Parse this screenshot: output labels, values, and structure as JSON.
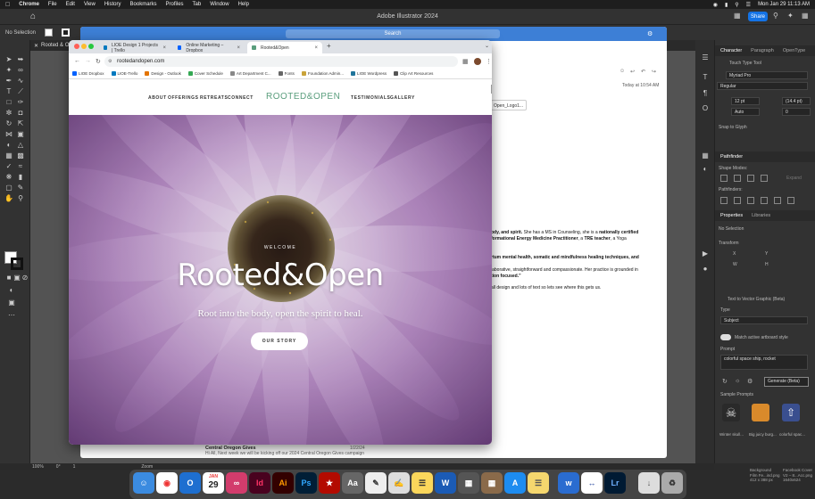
{
  "menubar": {
    "app": "Chrome",
    "items": [
      "File",
      "Edit",
      "View",
      "History",
      "Bookmarks",
      "Profiles",
      "Tab",
      "Window",
      "Help"
    ],
    "datetime": "Mon Jan 29 11:13 AM"
  },
  "illustrator": {
    "title": "Adobe Illustrator 2024",
    "share": "Share",
    "control_selection": "No Selection",
    "doc_tab": "Rooted & Ope",
    "zoom": "100%",
    "angle": "0°",
    "artboard": "1",
    "status": "Zoom"
  },
  "gmail": {
    "search": "Search",
    "time": "Today at 10:54 AM",
    "attachment": "Open_Logo1...",
    "body": [
      {
        "prefix": "",
        "bold": "ody, and spirit.",
        "rest": " She has a MS in Counseling, she is a "
      },
      {
        "prefix": "",
        "bold": "nationally certified",
        "rest": ""
      },
      {
        "prefix": "",
        "bold": "formational Energy Medicine Practitioner",
        "rest": ", a "
      },
      {
        "prefix": "",
        "bold": "TRE teacher",
        "rest": ", a Yoga"
      }
    ],
    "body_line5": "rtum mental health, somatic and mindfulness healing techniques, and",
    "body_line6": "laborative, straightforward and compassionate. Her practice is grounded in",
    "body_line7": "tion focused.”",
    "body_line8": "all design and lots of text so lets see where this gets us.",
    "footer_name": "Central Oregon Gives",
    "footer_line": "Hi All, Next week we will be kicking off our 2024 Central Oregon Gives campaign",
    "footer_date": "1/22/24"
  },
  "chrome": {
    "tabs": [
      {
        "label": "LIOE Design 1 Projects | Trello"
      },
      {
        "label": "Online Marketing – Dropbox"
      },
      {
        "label": "Rooted&Open"
      }
    ],
    "url": "rootedandopen.com",
    "bookmarks": [
      {
        "label": "LIOE Dropbox",
        "color": "#0061fe"
      },
      {
        "label": "LIOE-Trello",
        "color": "#0079bf"
      },
      {
        "label": "Design - Outlook",
        "color": "#e37400"
      },
      {
        "label": "Cover Schedule",
        "color": "#34a853"
      },
      {
        "label": "Art Department C...",
        "color": "#888"
      },
      {
        "label": "Fonts",
        "color": "#666"
      },
      {
        "label": "Foundation Admin...",
        "color": "#c9a33a"
      },
      {
        "label": "LIOE Wordpress",
        "color": "#21759b"
      },
      {
        "label": "Clip Art Resources",
        "color": "#555"
      }
    ]
  },
  "site": {
    "nav_left": [
      "ABOUT",
      "OFFERINGS",
      "RETREATS",
      "CONNECT"
    ],
    "logo": "ROOTED&OPEN",
    "nav_right": [
      "TESTIMONIALS",
      "GALLERY"
    ],
    "welcome": "WELCOME",
    "title": "Rooted&Open",
    "subtitle": "Root into the body, open the spirit to heal.",
    "cta": "OUR STORY"
  },
  "character_panel": {
    "tabs": [
      "Character",
      "Paragraph",
      "OpenType"
    ],
    "touch_tool": "Touch Type Tool",
    "font": "Myriad Pro",
    "style": "Regular",
    "size": "12 pt",
    "leading": "(14.4 pt)",
    "kerning": "Auto",
    "tracking": "0",
    "snap": "Snap to Glyph"
  },
  "pathfinder_panel": {
    "title": "Pathfinder",
    "shape_modes": "Shape Modes:",
    "expand": "Expand",
    "pathfinders": "Pathfinders:"
  },
  "properties_panel": {
    "tabs": [
      "Properties",
      "Libraries"
    ],
    "selection": "No Selection",
    "transform": "Transform",
    "x_label": "X",
    "y_label": "Y",
    "w_label": "W",
    "h_label": "H",
    "vector_title": "Text to Vector Graphic (Beta)",
    "type_label": "Type",
    "type_value": "Subject",
    "match_style": "Match active artboard style",
    "prompt_label": "Prompt",
    "prompt_value": "colorful space ship, rocket",
    "generate": "Generate (Beta)",
    "sample_prompts": "Sample Prompts",
    "samples": [
      "Winter skull...",
      "Big juicy burg...",
      "colorful spac..."
    ]
  },
  "dock": {
    "date_month": "JAN",
    "date_day": "29"
  },
  "corner_text": [
    "Background",
    "Film Fe...ind.png",
    "412 x 388 px",
    "Facebook Cover",
    "V2 – 8...Acc.png",
    "1640x624"
  ]
}
